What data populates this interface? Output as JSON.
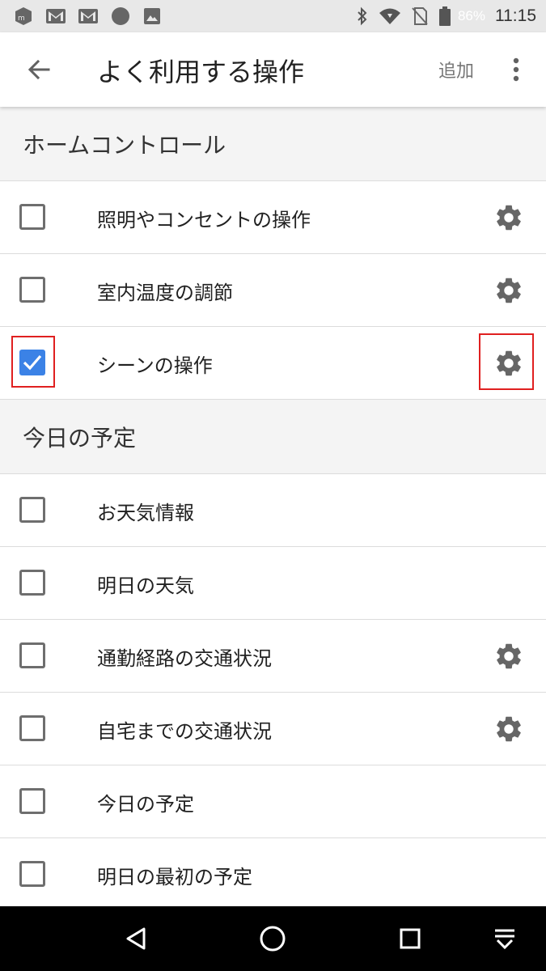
{
  "status_bar": {
    "left_icons": [
      "app-notification-icon",
      "gmail-icon",
      "gmail-icon",
      "circle-icon",
      "image-icon"
    ],
    "right_icons": [
      "bluetooth-icon",
      "wifi-icon",
      "no-sim-icon",
      "battery-icon"
    ],
    "battery": "86%",
    "time": "11:15"
  },
  "app_bar": {
    "title": "よく利用する操作",
    "add_label": "追加"
  },
  "sections": [
    {
      "header": "ホームコントロール",
      "items": [
        {
          "label": "照明やコンセントの操作",
          "checked": false,
          "has_settings": true
        },
        {
          "label": "室内温度の調節",
          "checked": false,
          "has_settings": true
        },
        {
          "label": "シーンの操作",
          "checked": true,
          "has_settings": true,
          "highlighted": true
        }
      ]
    },
    {
      "header": "今日の予定",
      "items": [
        {
          "label": "お天気情報",
          "checked": false,
          "has_settings": false
        },
        {
          "label": "明日の天気",
          "checked": false,
          "has_settings": false
        },
        {
          "label": "通勤経路の交通状況",
          "checked": false,
          "has_settings": true
        },
        {
          "label": "自宅までの交通状況",
          "checked": false,
          "has_settings": true
        },
        {
          "label": "今日の予定",
          "checked": false,
          "has_settings": false
        },
        {
          "label": "明日の最初の予定",
          "checked": false,
          "has_settings": false
        }
      ]
    }
  ],
  "nav_bar": {
    "buttons": [
      "back-triangle-icon",
      "home-circle-icon",
      "recents-square-icon",
      "notifications-down-icon"
    ]
  },
  "colors": {
    "accent": "#3b82e6",
    "highlight": "#e02020",
    "gear": "#666666"
  }
}
